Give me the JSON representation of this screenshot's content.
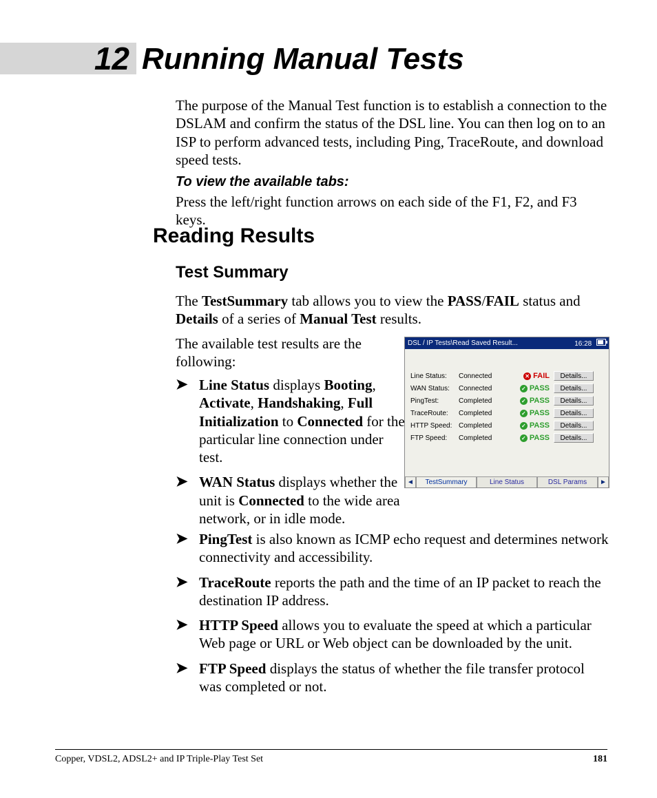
{
  "chapter": {
    "number": "12",
    "title": "Running Manual Tests"
  },
  "intro": "The purpose of the Manual Test function is to establish a connection to the DSLAM and confirm the status of the DSL line. You can then log on to an ISP to perform advanced tests, including Ping, TraceRoute, and download speed tests.",
  "view_tabs_heading": "To view the available tabs:",
  "view_tabs_text": "Press the left/right function arrows on each side of the F1, F2, and F3 keys.",
  "h2": "Reading Results",
  "h3": "Test Summary",
  "summary_para_pre": "The ",
  "summary_b1": "TestSummary",
  "summary_mid1": " tab allows you to view the ",
  "summary_b2": "PASS",
  "summary_slash": "/",
  "summary_b3": "FAIL",
  "summary_mid2": " status and ",
  "summary_b4": "Details",
  "summary_mid3": " of a series of ",
  "summary_b5": "Manual Test",
  "summary_end": " results.",
  "available_para": "The available test results are the following:",
  "bullets_narrow": [
    {
      "parts": [
        {
          "b": "Line Status"
        },
        {
          "t": " displays "
        },
        {
          "b": "Booting"
        },
        {
          "t": ", "
        },
        {
          "b": "Activate"
        },
        {
          "t": ", "
        },
        {
          "b": "Handshaking"
        },
        {
          "t": ", "
        },
        {
          "b": "Full Initialization"
        },
        {
          "t": " to "
        },
        {
          "b": "Connected"
        },
        {
          "t": " for the particular line connection under test."
        }
      ]
    },
    {
      "parts": [
        {
          "b": "WAN Status"
        },
        {
          "t": " displays whether the unit is "
        },
        {
          "b": "Connected"
        },
        {
          "t": " to the wide area network, or in idle mode."
        }
      ]
    }
  ],
  "bullets_wide": [
    {
      "parts": [
        {
          "b": "PingTest"
        },
        {
          "t": " is also known as ICMP echo request and determines network connectivity and accessibility."
        }
      ]
    },
    {
      "parts": [
        {
          "b": "TraceRoute"
        },
        {
          "t": " reports the path and the time of an IP packet to reach the destination IP address."
        }
      ]
    },
    {
      "parts": [
        {
          "b": "HTTP Speed"
        },
        {
          "t": " allows you to evaluate the speed at which a particular Web page or URL or Web object can be downloaded by the unit."
        }
      ]
    },
    {
      "parts": [
        {
          "b": "FTP Speed"
        },
        {
          "t": " displays the status of whether the file transfer protocol was completed or not."
        }
      ]
    }
  ],
  "screenshot": {
    "title": "DSL / IP Tests\\Read Saved Result...",
    "time": "16:28",
    "rows": [
      {
        "label": "Line Status:",
        "value": "Connected",
        "pf": "FAIL",
        "btn": "Details..."
      },
      {
        "label": "WAN Status:",
        "value": "Connected",
        "pf": "PASS",
        "btn": "Details..."
      },
      {
        "label": "PingTest:",
        "value": "Completed",
        "pf": "PASS",
        "btn": "Details..."
      },
      {
        "label": "TraceRoute:",
        "value": "Completed",
        "pf": "PASS",
        "btn": "Details..."
      },
      {
        "label": "HTTP Speed:",
        "value": "Completed",
        "pf": "PASS",
        "btn": "Details..."
      },
      {
        "label": "FTP Speed:",
        "value": "Completed",
        "pf": "PASS",
        "btn": "Details..."
      }
    ],
    "tabs": {
      "left_arrow": "◄",
      "t1": "TestSummary",
      "t2": "Line Status",
      "t3": "DSL Params",
      "right_arrow": "►"
    }
  },
  "footer": {
    "left": "Copper, VDSL2, ADSL2+ and IP Triple-Play Test Set",
    "page": "181"
  }
}
